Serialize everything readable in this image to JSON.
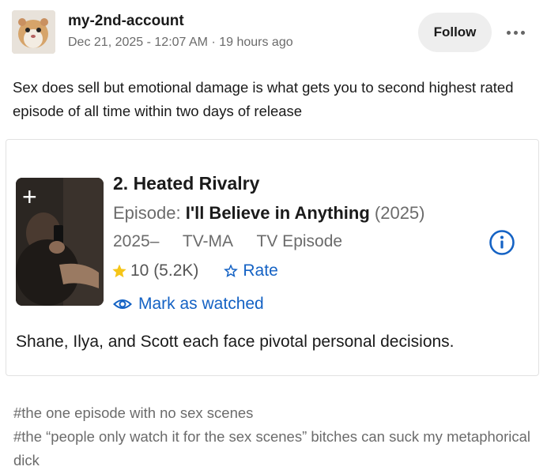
{
  "post": {
    "username": "my-2nd-account",
    "timestamp": "Dec 21, 2025 - 12:07 AM · 19 hours ago",
    "follow_label": "Follow",
    "more_icon": "more-dots-icon",
    "body": "Sex does sell but emotional damage is what gets you to second highest rated episode of all time within two days of release"
  },
  "card": {
    "title": "2. Heated Rivalry",
    "episode_prefix": "Episode:",
    "episode_name": "I'll Believe in Anything",
    "episode_year": "(2025)",
    "year_range": "2025–",
    "rating_code": "TV-MA",
    "type": "TV Episode",
    "score": "10 (5.2K)",
    "rate_label": "Rate",
    "watched_label": "Mark as watched",
    "description": "Shane, Ilya, and Scott each face pivotal personal decisions.",
    "add_icon": "plus-icon",
    "colors": {
      "link": "#1462c4",
      "star": "#f5c518"
    }
  },
  "tags": [
    "#the one episode with no sex scenes",
    "#the “people only watch it for the sex scenes” bitches can suck my metaphorical dick"
  ]
}
